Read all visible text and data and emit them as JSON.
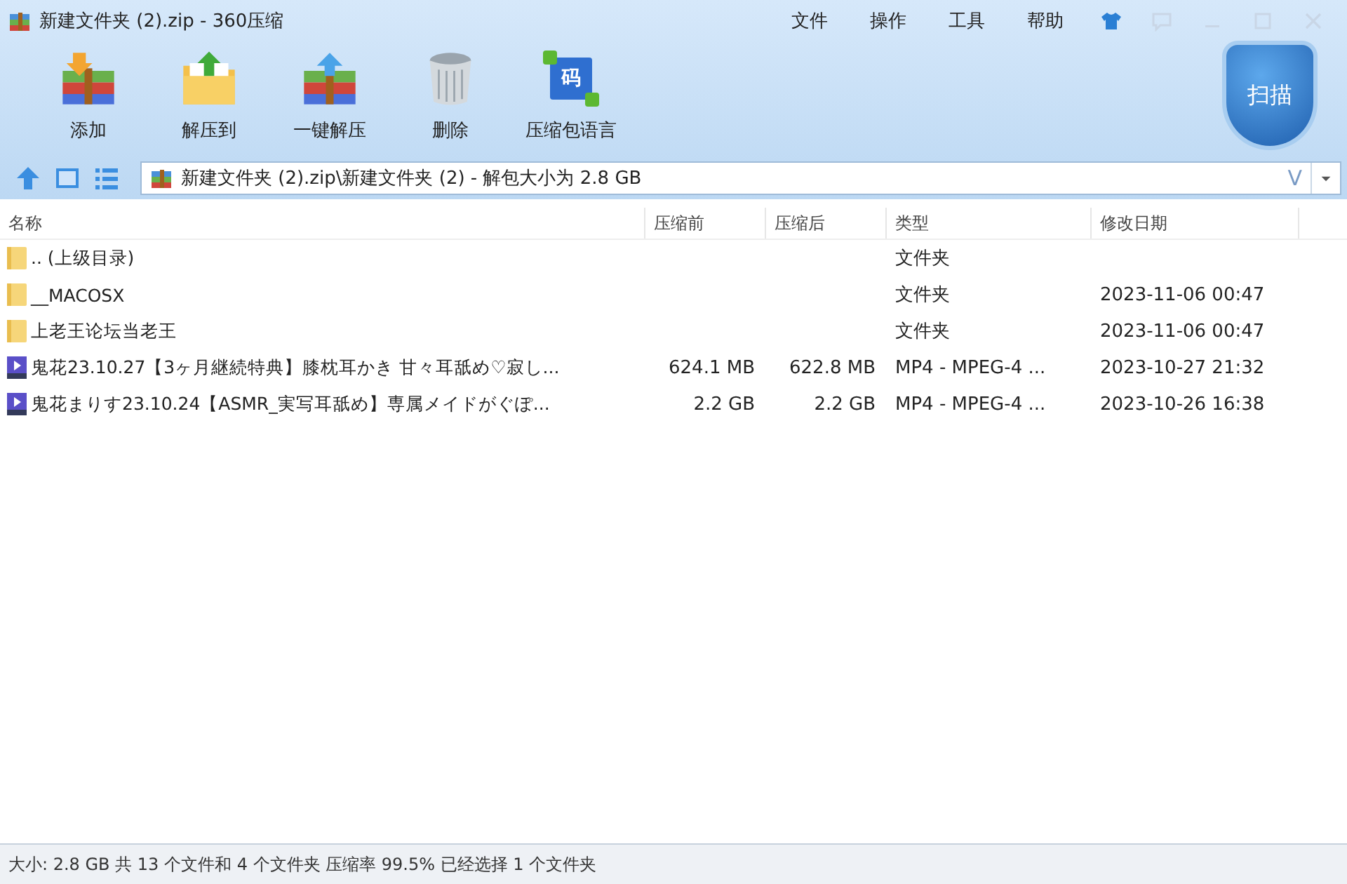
{
  "window": {
    "title": "新建文件夹 (2).zip - 360压缩"
  },
  "menu": [
    "文件",
    "操作",
    "工具",
    "帮助"
  ],
  "toolbar": [
    {
      "kind": "add",
      "label": "添加"
    },
    {
      "kind": "extract",
      "label": "解压到"
    },
    {
      "kind": "oneclick",
      "label": "一键解压"
    },
    {
      "kind": "delete",
      "label": "删除"
    },
    {
      "kind": "language",
      "label": "压缩包语言",
      "icon_text": "码"
    }
  ],
  "scan_button": {
    "label": "扫描"
  },
  "address": {
    "path": "新建文件夹 (2).zip\\新建文件夹 (2) - 解包大小为 2.8 GB",
    "go_label": "V"
  },
  "table": {
    "columns": [
      "名称",
      "压缩前",
      "压缩后",
      "类型",
      "修改日期"
    ],
    "rows": [
      {
        "kind": "folder",
        "name": ".. (上级目录)",
        "original": "",
        "compressed": "",
        "type": "文件夹",
        "modified": ""
      },
      {
        "kind": "folder",
        "name": "__MACOSX",
        "original": "",
        "compressed": "",
        "type": "文件夹",
        "modified": "2023-11-06 00:47"
      },
      {
        "kind": "folder",
        "name": "上老王论坛当老王",
        "original": "",
        "compressed": "",
        "type": "文件夹",
        "modified": "2023-11-06 00:47"
      },
      {
        "kind": "video",
        "name": "鬼花23.10.27【3ヶ月継続特典】膝枕耳かき 甘々耳舐め♡寂し...",
        "original": "624.1 MB",
        "compressed": "622.8 MB",
        "type": "MP4 - MPEG-4 ...",
        "modified": "2023-10-27 21:32"
      },
      {
        "kind": "video",
        "name": "鬼花まりす23.10.24【ASMR_実写耳舐め】専属メイドがぐぽ...",
        "original": "2.2 GB",
        "compressed": "2.2 GB",
        "type": "MP4 - MPEG-4 ...",
        "modified": "2023-10-26 16:38"
      }
    ]
  },
  "status_bar": "大小: 2.8 GB 共 13 个文件和 4 个文件夹 压缩率 99.5% 已经选择 1 个文件夹"
}
